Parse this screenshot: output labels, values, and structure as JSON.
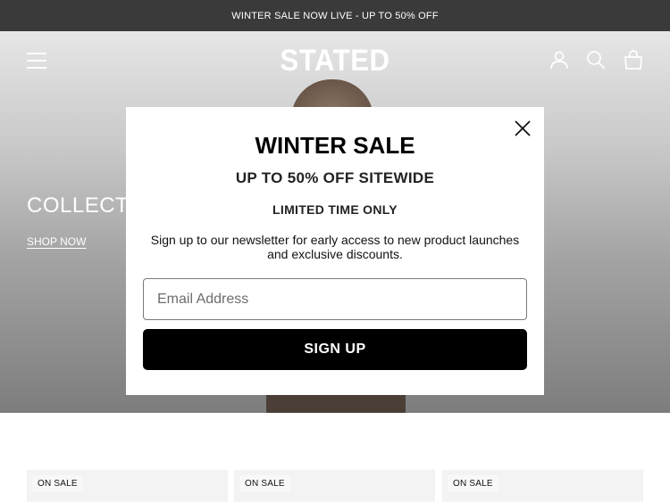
{
  "announcement": {
    "text": "WINTER SALE NOW LIVE - UP TO 50% OFF"
  },
  "header": {
    "logo": "STATED",
    "icons": [
      "menu-icon",
      "account-icon",
      "search-icon",
      "cart-icon"
    ]
  },
  "hero": {
    "title": "COLLECTION",
    "link": "SHOP NOW"
  },
  "popup": {
    "title": "WINTER SALE",
    "subtitle": "UP TO 50% OFF SITEWIDE",
    "limited": "LIMITED TIME ONLY",
    "description": "Sign up to our newsletter for early access to new product launches and exclusive discounts.",
    "email_placeholder": "Email Address",
    "button": "SIGN UP"
  },
  "products": [
    {
      "badge": "ON SALE"
    },
    {
      "badge": "ON SALE"
    },
    {
      "badge": "ON SALE"
    }
  ],
  "colors": {
    "announcement_bg": "#3a3a3a",
    "button_bg": "#000000",
    "text": "#111111"
  }
}
